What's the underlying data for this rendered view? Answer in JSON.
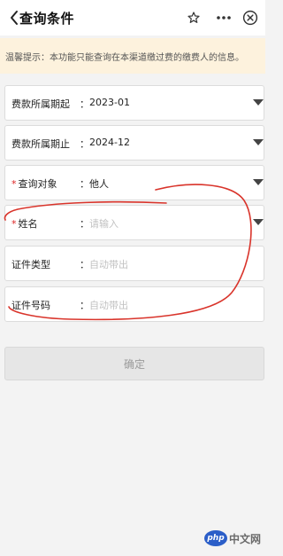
{
  "header": {
    "title": "查询条件"
  },
  "notice": {
    "text": "温馨提示：本功能只能查询在本渠道缴过费的缴费人的信息。"
  },
  "form": {
    "fields": [
      {
        "label": "费款所属期起",
        "colon": "：",
        "value": "2023-01",
        "placeholder": "",
        "required": false,
        "dropdown": true
      },
      {
        "label": "费款所属期止",
        "colon": "：",
        "value": "2024-12",
        "placeholder": "",
        "required": false,
        "dropdown": true
      },
      {
        "label": "查询对象",
        "colon": "：",
        "value": "他人",
        "placeholder": "",
        "required": true,
        "required_mark": "*",
        "dropdown": true
      },
      {
        "label": "姓名",
        "colon": "：",
        "value": "",
        "placeholder": "请输入",
        "required": true,
        "required_mark": "*",
        "dropdown": true
      },
      {
        "label": "证件类型",
        "colon": "：",
        "value": "",
        "placeholder": "自动带出",
        "required": false,
        "dropdown": false
      },
      {
        "label": "证件号码",
        "colon": "：",
        "value": "",
        "placeholder": "自动带出",
        "required": false,
        "dropdown": false
      }
    ],
    "confirm_label": "确定"
  },
  "watermark": {
    "logo_text": "php",
    "text": "中文网"
  },
  "colors": {
    "notice_bg": "#fdf2dd",
    "required": "#dd2222",
    "annotation_stroke": "#d9342b"
  },
  "icons": {
    "back": "chevron-left-icon",
    "star": "star-outline-icon",
    "more": "more-dots-icon",
    "close": "close-circle-icon",
    "dropdown": "caret-down-icon"
  }
}
